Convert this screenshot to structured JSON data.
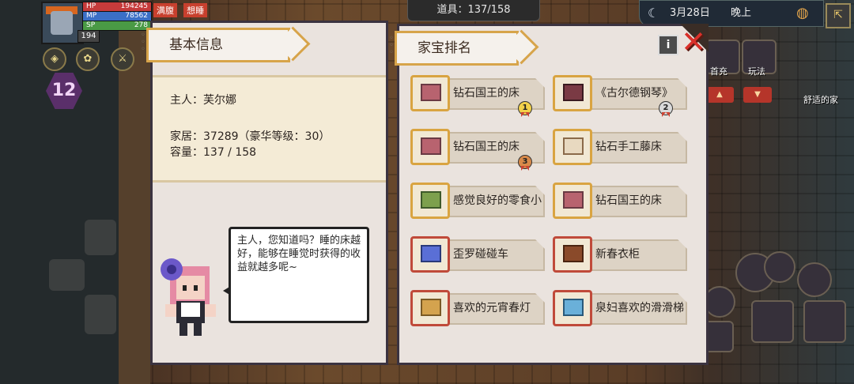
{
  "hud": {
    "hp_label": "HP",
    "hp_value": "194245",
    "mp_label": "MP",
    "mp_value": "78562",
    "sp_label": "SP",
    "sp_value": "278",
    "player_level": "194",
    "zone_level": "12",
    "tabs": [
      "满腹",
      "想睡"
    ],
    "colors": {
      "hp": "#c63b3b",
      "mp": "#3b6fc6",
      "sp": "#4a9a45"
    }
  },
  "top": {
    "items_count": "道具：137/158",
    "date": "3月28日",
    "time_of_day": "晚上"
  },
  "right_side": {
    "label_first_charge": "首充",
    "label_gameplay": "玩法",
    "label_home": "舒适的家"
  },
  "basic_info": {
    "title": "基本信息",
    "owner": "主人：芙尔娜",
    "furniture": "家居：37289（豪华等级：30）",
    "capacity": "容量：137 / 158",
    "speech": "主人，您知道吗？睡的床越好，能够在睡觉时获得的收益就越多呢~"
  },
  "ranking": {
    "title": "家宝排名",
    "items": [
      {
        "name": "钻石国王的床",
        "medal": "1"
      },
      {
        "name": "《古尔德钢琴》",
        "medal": "2"
      },
      {
        "name": "钻石国王的床",
        "medal": "3"
      },
      {
        "name": "钻石手工藤床",
        "medal": ""
      },
      {
        "name": "感觉良好的零食小",
        "medal": ""
      },
      {
        "name": "钻石国王的床",
        "medal": ""
      },
      {
        "name": "歪罗碰碰车",
        "medal": ""
      },
      {
        "name": "新春衣柜",
        "medal": ""
      },
      {
        "name": "喜欢的元宵春灯",
        "medal": ""
      },
      {
        "name": "泉妇喜欢的滑滑梯",
        "medal": ""
      }
    ],
    "info_label": "i",
    "close_label": "✕"
  }
}
